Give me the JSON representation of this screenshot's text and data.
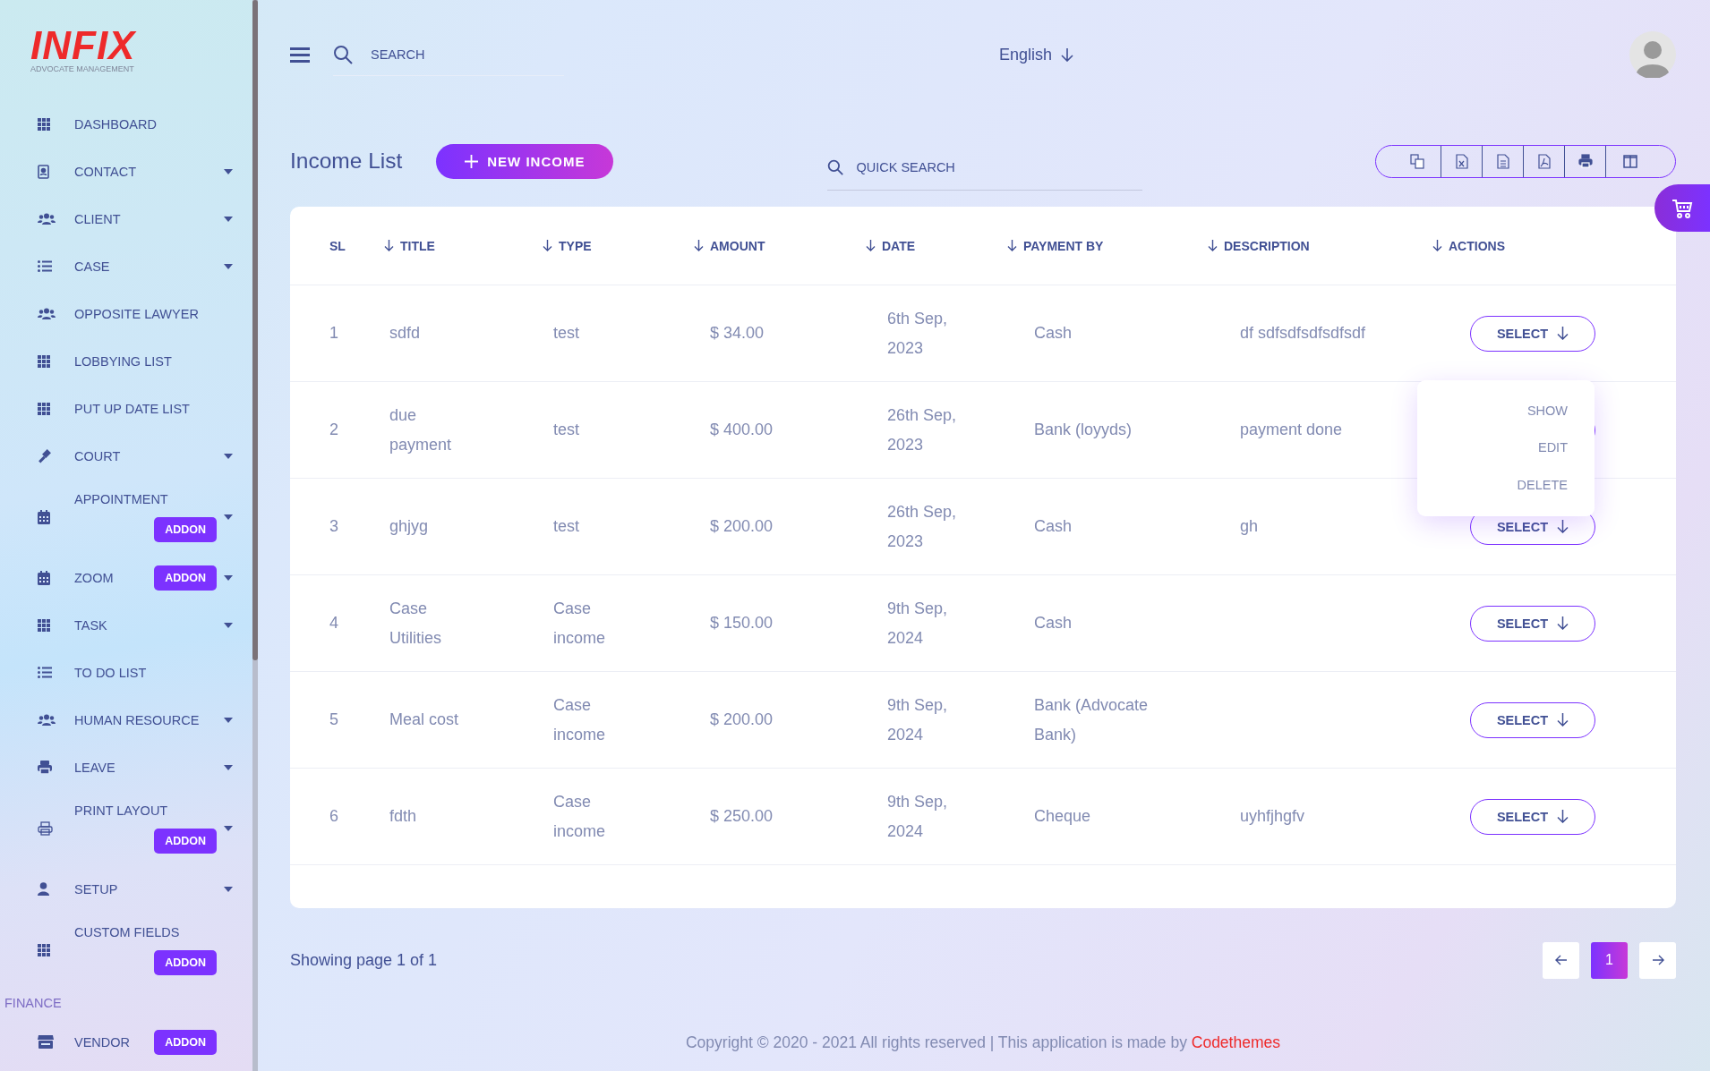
{
  "logo": {
    "name": "INFIX",
    "tagline": "ADVOCATE MANAGEMENT"
  },
  "sidebar": {
    "items": [
      {
        "kind": "link",
        "label": "DASHBOARD",
        "has_submenu": false
      },
      {
        "kind": "link",
        "label": "CONTACT",
        "has_submenu": true
      },
      {
        "kind": "link",
        "label": "CLIENT",
        "has_submenu": true
      },
      {
        "kind": "link",
        "label": "CASE",
        "has_submenu": true
      },
      {
        "kind": "link",
        "label": "OPPOSITE LAWYER",
        "has_submenu": false
      },
      {
        "kind": "link",
        "label": "LOBBYING LIST",
        "has_submenu": false
      },
      {
        "kind": "link",
        "label": "PUT UP DATE LIST",
        "has_submenu": false
      },
      {
        "kind": "link",
        "label": "COURT",
        "has_submenu": true
      },
      {
        "kind": "link",
        "label": "APPOINTMENT",
        "has_submenu": true,
        "badge": "ADDON",
        "badge_below": true
      },
      {
        "kind": "link",
        "label": "ZOOM",
        "has_submenu": true,
        "badge": "ADDON",
        "badge_below": false
      },
      {
        "kind": "link",
        "label": "TASK",
        "has_submenu": true
      },
      {
        "kind": "link",
        "label": "TO DO LIST",
        "has_submenu": false
      },
      {
        "kind": "link",
        "label": "HUMAN RESOURCE",
        "has_submenu": true
      },
      {
        "kind": "link",
        "label": "LEAVE",
        "has_submenu": true
      },
      {
        "kind": "link",
        "label": "PRINT LAYOUT",
        "has_submenu": true,
        "badge": "ADDON",
        "badge_below": true
      },
      {
        "kind": "link",
        "label": "SETUP",
        "has_submenu": true
      },
      {
        "kind": "link",
        "label": "CUSTOM FIELDS",
        "has_submenu": false,
        "badge": "ADDON",
        "badge_below": true
      },
      {
        "kind": "section",
        "label": "FINANCE"
      },
      {
        "kind": "link",
        "label": "VENDOR",
        "has_submenu": false,
        "badge": "ADDON",
        "badge_below": false
      }
    ]
  },
  "header": {
    "search": {
      "placeholder": "SEARCH"
    },
    "language": "English"
  },
  "page": {
    "title": "Income List",
    "new_button": "NEW INCOME",
    "quick_search": {
      "placeholder": "QUICK SEARCH"
    }
  },
  "table": {
    "columns": [
      "SL",
      "TITLE",
      "TYPE",
      "AMOUNT",
      "DATE",
      "PAYMENT BY",
      "DESCRIPTION",
      "ACTIONS"
    ],
    "rows": [
      {
        "sl": "1",
        "title": "sdfd",
        "type": "test",
        "amount": "$ 34.00",
        "date": "6th Sep, 2023",
        "payment_by": "Cash",
        "description": "df sdfsdfsdfsdfsdf",
        "action": "SELECT",
        "menu_open": true,
        "menu": [
          "SHOW",
          "EDIT",
          "DELETE"
        ]
      },
      {
        "sl": "2",
        "title": "due payment",
        "type": "test",
        "amount": "$ 400.00",
        "date": "26th Sep, 2023",
        "payment_by": "Bank (loyyds)",
        "description": "payment done"
      },
      {
        "sl": "3",
        "title": "ghjyg",
        "type": "test",
        "amount": "$ 200.00",
        "date": "26th Sep, 2023",
        "payment_by": "Cash",
        "description": "gh",
        "action": "SELECT",
        "menu_open": false
      },
      {
        "sl": "4",
        "title": "Case Utilities",
        "type": "Case income",
        "amount": "$ 150.00",
        "date": "9th Sep, 2024",
        "payment_by": "Cash",
        "action": "SELECT",
        "menu_open": false
      },
      {
        "sl": "5",
        "title": "Meal cost",
        "type": "Case income",
        "amount": "$ 200.00",
        "date": "9th Sep, 2024",
        "payment_by": "Bank (Advocate Bank)",
        "action": "SELECT",
        "menu_open": false
      },
      {
        "sl": "6",
        "title": "fdth",
        "type": "Case income",
        "amount": "$ 250.00",
        "date": "9th Sep, 2024",
        "payment_by": "Cheque",
        "description": "uyhfjhgfv",
        "action": "SELECT",
        "menu_open": false
      }
    ]
  },
  "pagination": {
    "summary": "Showing page 1 of 1",
    "pages": [
      {
        "label": "1",
        "selected": true
      }
    ]
  },
  "footer": {
    "text": "Copyright © 2020 - 2021 All rights reserved | This application is made by",
    "link": "Codethemes"
  }
}
